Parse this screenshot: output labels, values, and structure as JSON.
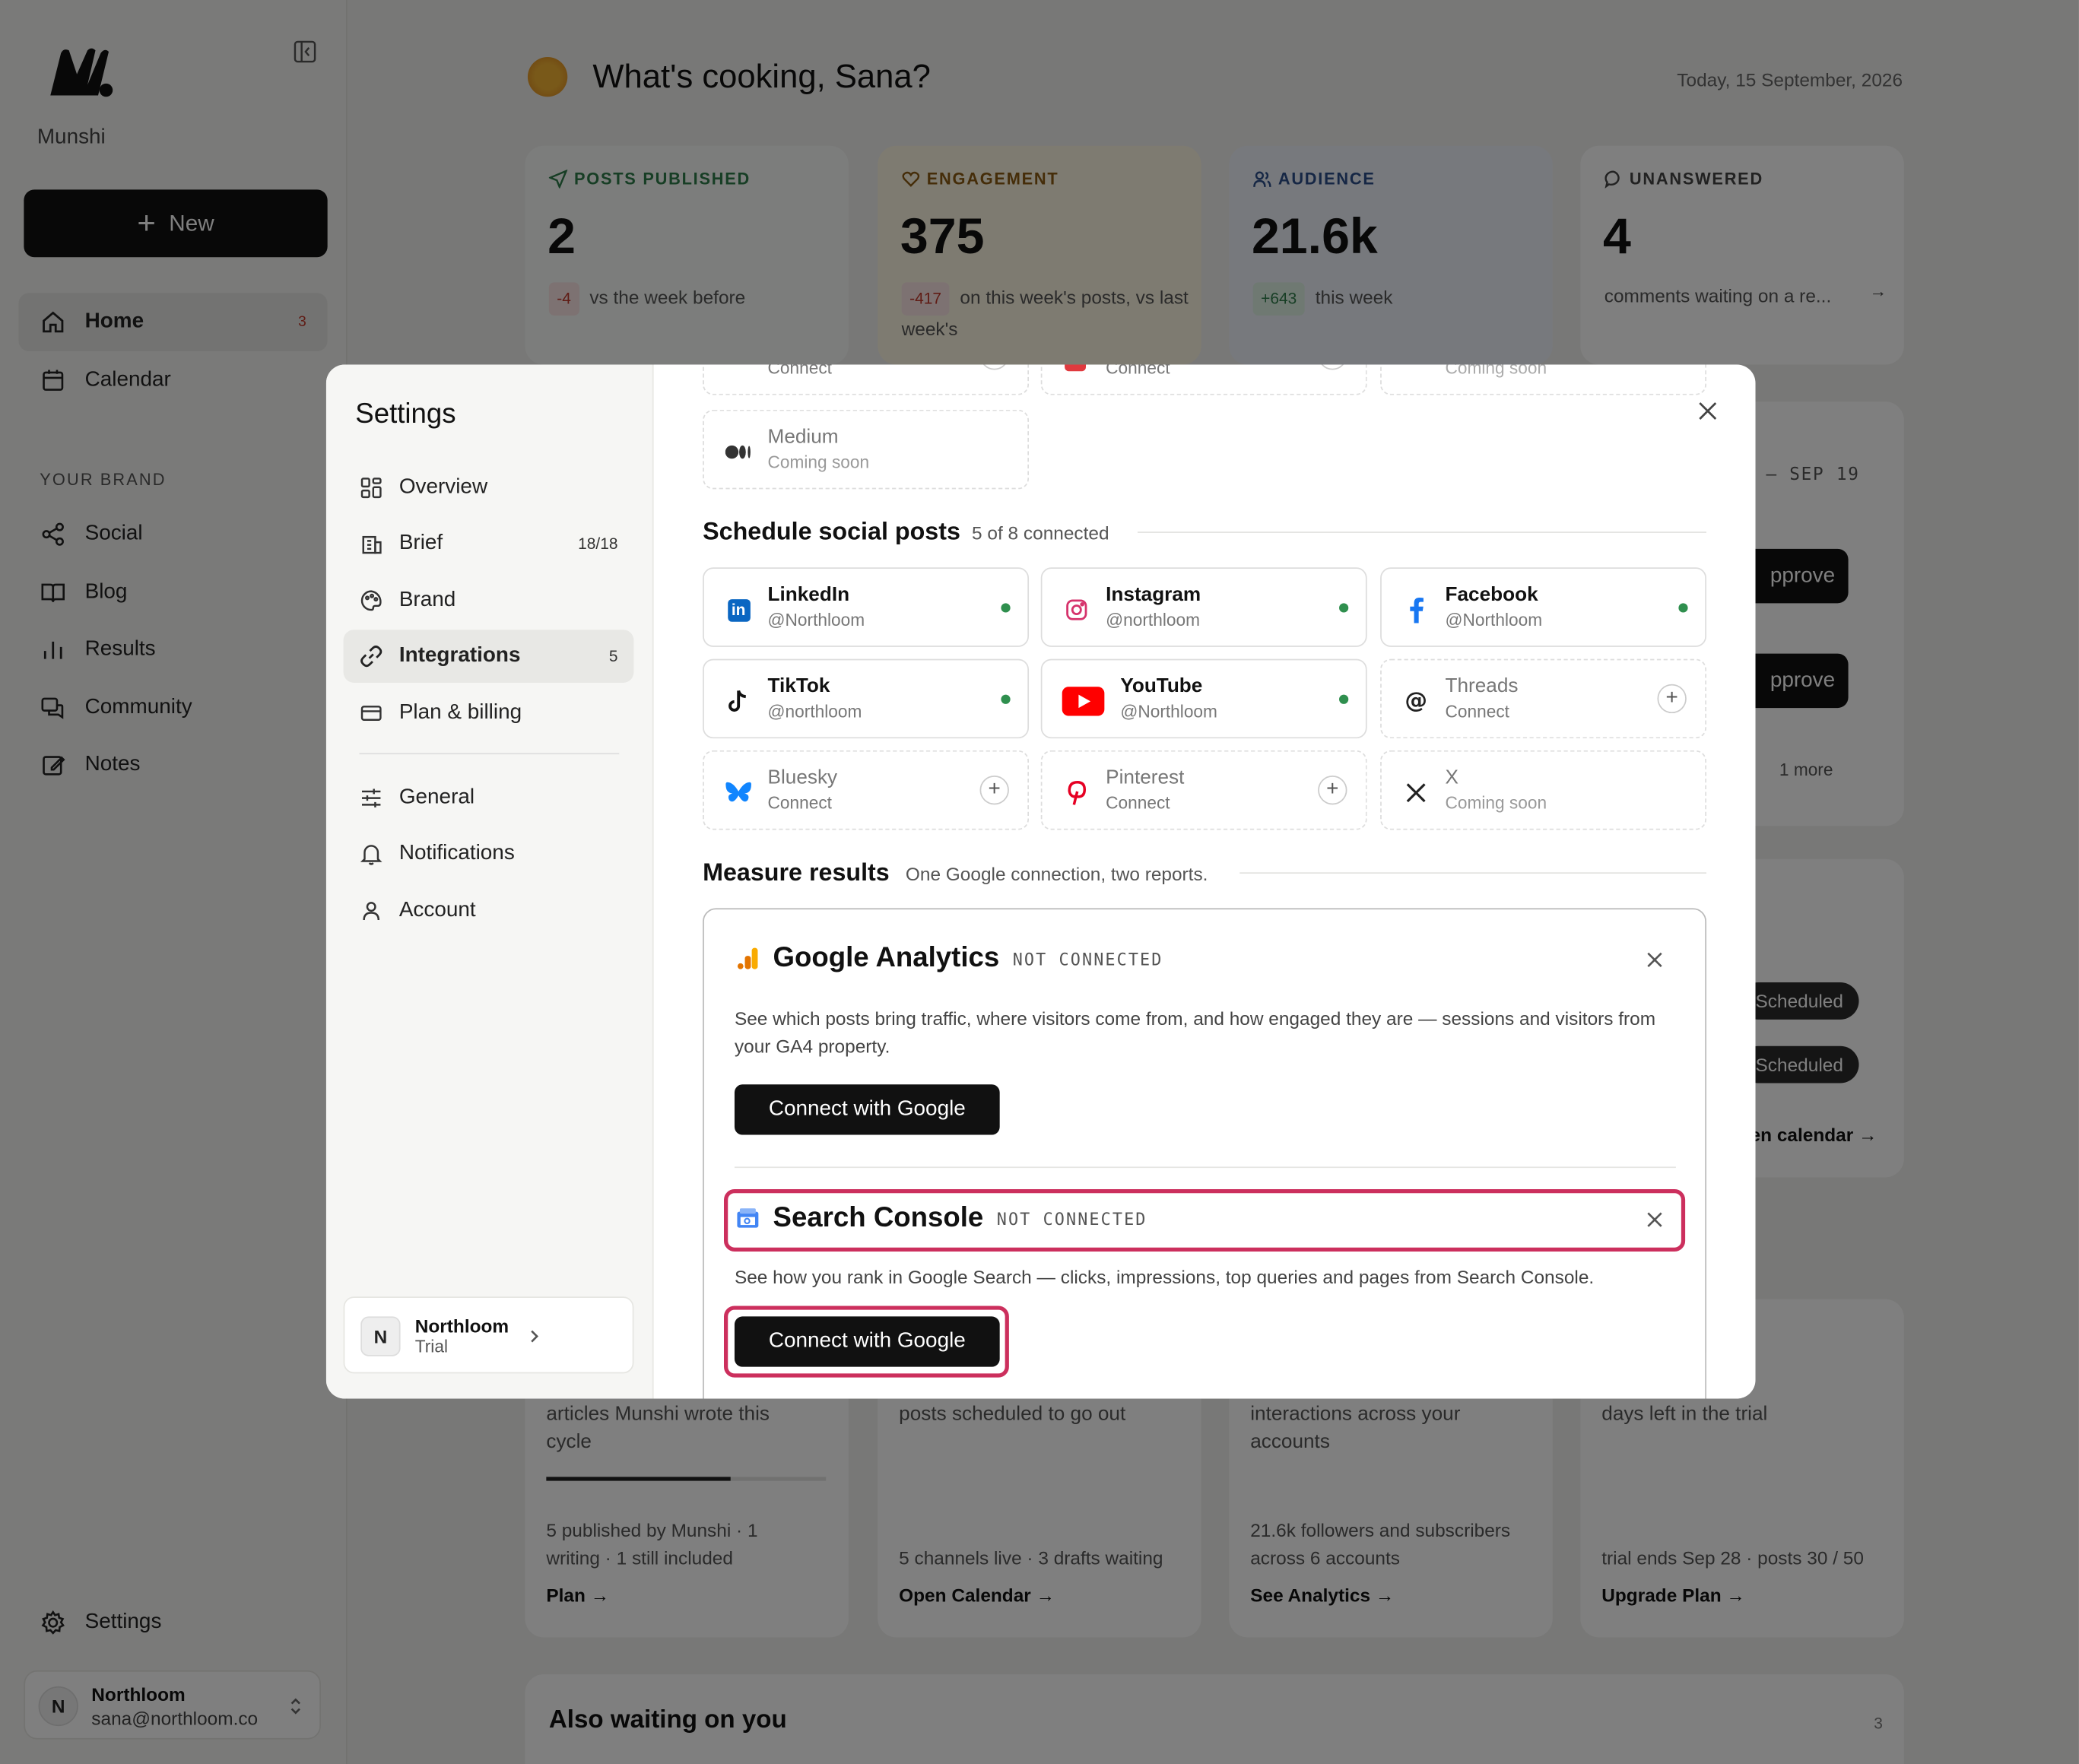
{
  "app": {
    "name": "Munshi",
    "new_label": "New",
    "nav": [
      {
        "label": "Home",
        "count": "3"
      },
      {
        "label": "Calendar"
      }
    ],
    "section_label": "YOUR BRAND",
    "brand_nav": [
      {
        "label": "Social"
      },
      {
        "label": "Blog"
      },
      {
        "label": "Results"
      },
      {
        "label": "Community"
      },
      {
        "label": "Notes"
      }
    ],
    "settings_label": "Settings",
    "user": {
      "initial": "N",
      "name": "Northloom",
      "email": "sana@northloom.co"
    }
  },
  "header": {
    "greeting": "What's cooking, Sana?",
    "date": "Today, 15 September, 2026"
  },
  "stats": [
    {
      "label": "POSTS PUBLISHED",
      "value": "2",
      "delta": "-4",
      "note": "vs the week before",
      "color": "#2f7d4a"
    },
    {
      "label": "ENGAGEMENT",
      "value": "375",
      "delta": "-417",
      "note": "on this week's posts, vs last week's",
      "color": "#8a5a12"
    },
    {
      "label": "AUDIENCE",
      "value": "21.6k",
      "delta": "+643",
      "note": "this week",
      "color": "#2d4f8a"
    },
    {
      "label": "UNANSWERED",
      "value": "4",
      "note": "comments waiting on a re...",
      "color": "#444"
    }
  ],
  "background": {
    "date_range": "– SEP 19",
    "approve_1": "pprove",
    "approve_2": "pprove",
    "more": "1 more",
    "scheduled_1": "Scheduled",
    "scheduled_2": "Scheduled",
    "open_calendar": "en calendar →",
    "cards": [
      {
        "text": "articles Munshi wrote this cycle",
        "foot": "5 published by Munshi · 1 writing · 1 still included",
        "link": "Plan →"
      },
      {
        "text": "posts scheduled to go out",
        "foot": "5 channels live · 3 drafts waiting",
        "link": "Open Calendar →"
      },
      {
        "text": "interactions across your accounts",
        "foot": "21.6k followers and subscribers across 6 accounts",
        "link": "See Analytics →"
      },
      {
        "text": "days left in the trial",
        "foot": "trial ends Sep 28 · posts 30 / 50",
        "link": "Upgrade Plan →"
      }
    ],
    "waiting_title": "Also waiting on you",
    "waiting_count": "3"
  },
  "settings": {
    "title": "Settings",
    "nav": [
      {
        "label": "Overview"
      },
      {
        "label": "Brief",
        "count": "18/18"
      },
      {
        "label": "Brand"
      },
      {
        "label": "Integrations",
        "count": "5"
      },
      {
        "label": "Plan & billing"
      },
      {
        "label": "General"
      },
      {
        "label": "Notifications"
      },
      {
        "label": "Account"
      }
    ],
    "org": {
      "initial": "N",
      "name": "Northloom",
      "plan": "Trial"
    },
    "top_row": [
      {
        "sub": "Connect"
      },
      {
        "sub": "Connect"
      },
      {
        "sub": "Coming soon"
      }
    ],
    "medium": {
      "name": "Medium",
      "sub": "Coming soon"
    },
    "social": {
      "title": "Schedule social posts",
      "subtitle": "5 of 8 connected",
      "items": [
        {
          "name": "LinkedIn",
          "sub": "@Northloom",
          "status": "connected"
        },
        {
          "name": "Instagram",
          "sub": "@northloom",
          "status": "connected"
        },
        {
          "name": "Facebook",
          "sub": "@Northloom",
          "status": "connected"
        },
        {
          "name": "TikTok",
          "sub": "@northloom",
          "status": "connected"
        },
        {
          "name": "YouTube",
          "sub": "@Northloom",
          "status": "connected"
        },
        {
          "name": "Threads",
          "sub": "Connect",
          "status": "connect"
        },
        {
          "name": "Bluesky",
          "sub": "Connect",
          "status": "connect"
        },
        {
          "name": "Pinterest",
          "sub": "Connect",
          "status": "connect"
        },
        {
          "name": "X",
          "sub": "Coming soon",
          "status": "soon"
        }
      ]
    },
    "measure": {
      "title": "Measure results",
      "subtitle": "One Google connection, two reports.",
      "ga": {
        "name": "Google Analytics",
        "status": "NOT CONNECTED",
        "desc": "See which posts bring traffic, where visitors come from, and how engaged they are — sessions and visitors from your GA4 property.",
        "button": "Connect with Google"
      },
      "sc": {
        "name": "Search Console",
        "status": "NOT CONNECTED",
        "desc": "See how you rank in Google Search — clicks, impressions, top queries and pages from Search Console.",
        "button": "Connect with Google"
      }
    }
  }
}
